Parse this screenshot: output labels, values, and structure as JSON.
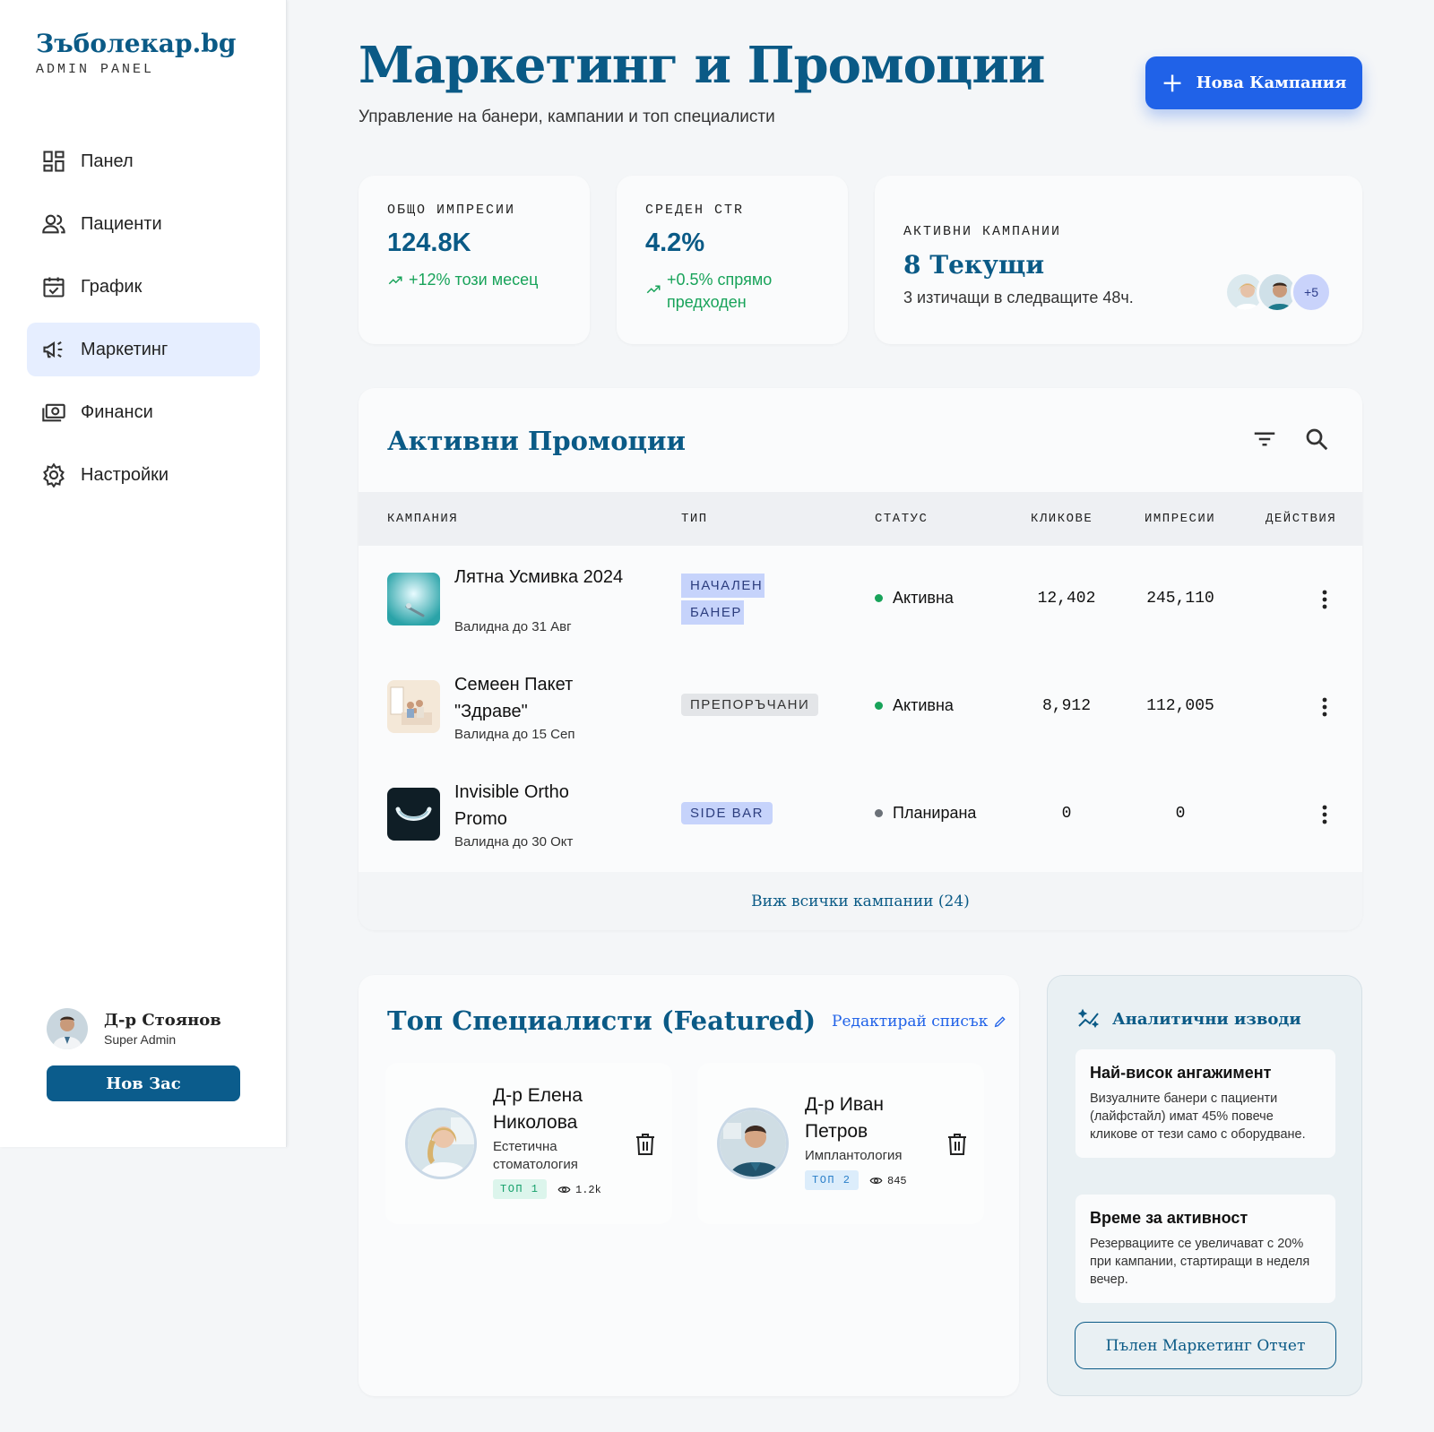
{
  "brand": {
    "name": "Зъболекар.bg",
    "subtitle": "ADMIN PANEL"
  },
  "sidebar": {
    "items": [
      {
        "label": "Панел",
        "icon": "dashboard-icon"
      },
      {
        "label": "Пациенти",
        "icon": "users-icon"
      },
      {
        "label": "График",
        "icon": "calendar-check-icon"
      },
      {
        "label": "Маркетинг",
        "icon": "megaphone-icon",
        "active": true
      },
      {
        "label": "Финанси",
        "icon": "money-icon"
      },
      {
        "label": "Настройки",
        "icon": "gear-icon"
      }
    ],
    "user": {
      "name": "Д-р Стоянов",
      "role": "Super Admin"
    },
    "new_button": "Нов Зас"
  },
  "header": {
    "title": "Маркетинг и Промоции",
    "subtitle": "Управление на банери, кампании и топ специалисти",
    "primary_button": "Нова Кампания"
  },
  "stats": {
    "impressions": {
      "label": "ОБЩО ИМПРЕСИИ",
      "value": "124.8K",
      "trend": "+12% този месец"
    },
    "ctr": {
      "label": "СРЕДЕН CTR",
      "value": "4.2%",
      "trend": "+0.5% спрямо предходен"
    },
    "active": {
      "label": "АКТИВНИ КАМПАНИИ",
      "value": "8 Текущи",
      "note": "3 изтичащи в следващите 48ч.",
      "more": "+5"
    }
  },
  "promotions": {
    "title": "Активни Промоции",
    "columns": [
      "КАМПАНИЯ",
      "ТИП",
      "СТАТУС",
      "КЛИКОВЕ",
      "ИМПРЕСИИ",
      "ДЕЙСТВИЯ"
    ],
    "rows": [
      {
        "name": "Лятна Усмивка 2024",
        "valid": "Валидна до 31 Авг",
        "type": "НАЧАЛЕН БАНЕР",
        "status": "Активна",
        "clicks": "12,402",
        "impressions": "245,110"
      },
      {
        "name": "Семеен Пакет \"Здраве\"",
        "valid": "Валидна до 15 Сеп",
        "type": "ПРЕПОРЪЧАНИ",
        "status": "Активна",
        "clicks": "8,912",
        "impressions": "112,005"
      },
      {
        "name": "Invisible Ortho Promo",
        "valid": "Валидна до 30 Окт",
        "type": "SIDE BAR",
        "status": "Планирана",
        "clicks": "0",
        "impressions": "0"
      }
    ],
    "footer": "Виж всички кампании (24)"
  },
  "specialists": {
    "title": "Топ Специалисти (Featured)",
    "edit": "Редактирай списък",
    "doctors": [
      {
        "name": "Д-р Елена Николова",
        "specialty": "Естетична стоматология",
        "rank": "ТОП 1",
        "views": "1.2k"
      },
      {
        "name": "Д-р Иван Петров",
        "specialty": "Имплантология",
        "rank": "ТОП 2",
        "views": "845"
      }
    ]
  },
  "analytics": {
    "title": "Аналитични изводи",
    "insights": [
      {
        "title": "Най-висок ангажимент",
        "text": "Визуалните банери с пациенти (лайфстайл) имат 45% повече кликове от тези само с оборудване."
      },
      {
        "title": "Време за активност",
        "text": "Резервациите се увеличават с 20% при кампании, стартиращи в неделя вечер."
      }
    ],
    "button": "Пълен Маркетинг Отчет"
  },
  "colors": {
    "primary": "#0a5a86",
    "accent": "#2062e8",
    "success": "#18a35a",
    "active_nav": "#e6eeff"
  }
}
